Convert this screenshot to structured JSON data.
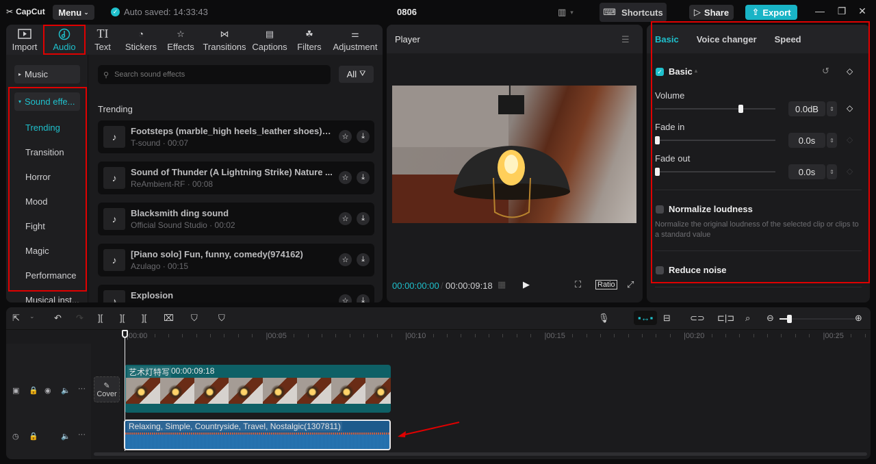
{
  "app": {
    "name": "CapCut",
    "menu_label": "Menu",
    "autosave": "Auto saved: 14:33:43",
    "project_title": "0806"
  },
  "titlebar": {
    "shortcuts_label": "Shortcuts",
    "share_label": "Share",
    "export_label": "Export"
  },
  "toolbar": {
    "items": [
      {
        "label": "Import",
        "icon": "import-icon"
      },
      {
        "label": "Audio",
        "icon": "audio-icon",
        "active": true
      },
      {
        "label": "Text",
        "icon": "text-icon"
      },
      {
        "label": "Stickers",
        "icon": "stickers-icon"
      },
      {
        "label": "Effects",
        "icon": "effects-icon"
      },
      {
        "label": "Transitions",
        "icon": "transitions-icon"
      },
      {
        "label": "Captions",
        "icon": "captions-icon"
      },
      {
        "label": "Filters",
        "icon": "filters-icon"
      },
      {
        "label": "Adjustment",
        "icon": "adjustment-icon"
      }
    ]
  },
  "categories": {
    "music": "Music",
    "sound_effects": "Sound effe...",
    "sub": [
      "Trending",
      "Transition",
      "Horror",
      "Mood",
      "Fight",
      "Magic",
      "Performance",
      "Musical inst..."
    ],
    "active_sub": "Trending"
  },
  "library": {
    "search_placeholder": "Search sound effects",
    "filter_label": "All",
    "section_title": "Trending",
    "items": [
      {
        "title": "Footsteps (marble_high heels_leather shoes)(1...",
        "meta": "T-sound · 00:07"
      },
      {
        "title": "Sound of Thunder (A Lightning Strike) Nature ...",
        "meta": "ReAmbient-RF · 00:08"
      },
      {
        "title": "Blacksmith ding sound",
        "meta": "Official Sound Studio · 00:02"
      },
      {
        "title": "[Piano solo] Fun, funny, comedy(974162)",
        "meta": "Azulago · 00:15"
      },
      {
        "title": "Explosion",
        "meta": ""
      }
    ]
  },
  "player": {
    "title": "Player",
    "current_time": "00:00:00:00",
    "total_time": "00:00:09:18",
    "ratio_label": "Ratio"
  },
  "inspector": {
    "tabs": [
      "Basic",
      "Voice changer",
      "Speed"
    ],
    "active_tab": "Basic",
    "section": "Basic",
    "volume": {
      "label": "Volume",
      "value": "0.0dB",
      "slider_fraction": 0.72
    },
    "fade_in": {
      "label": "Fade in",
      "value": "0.0s",
      "slider_fraction": 0.0
    },
    "fade_out": {
      "label": "Fade out",
      "value": "0.0s",
      "slider_fraction": 0.0
    },
    "normalize": {
      "label": "Normalize loudness",
      "checked": false,
      "hint": "Normalize the original loudness of the selected clip or clips to a standard value"
    },
    "reduce_noise": {
      "label": "Reduce noise",
      "checked": false
    }
  },
  "timeline": {
    "ruler": [
      "00:00",
      "00:05",
      "00:10",
      "00:15",
      "00:20",
      "00:25"
    ],
    "cover_label": "Cover",
    "video_clip": {
      "name": "艺术灯特写",
      "duration": "00:00:09:18"
    },
    "audio_clip": {
      "name": "Relaxing, Simple, Countryside, Travel, Nostalgic(1307811)"
    },
    "zoom_fraction": 0.1
  },
  "colors": {
    "accent": "#1fc0cc",
    "highlight_box": "#e00000",
    "video_clip": "#0e6066",
    "audio_clip": "#1d5a8c"
  }
}
